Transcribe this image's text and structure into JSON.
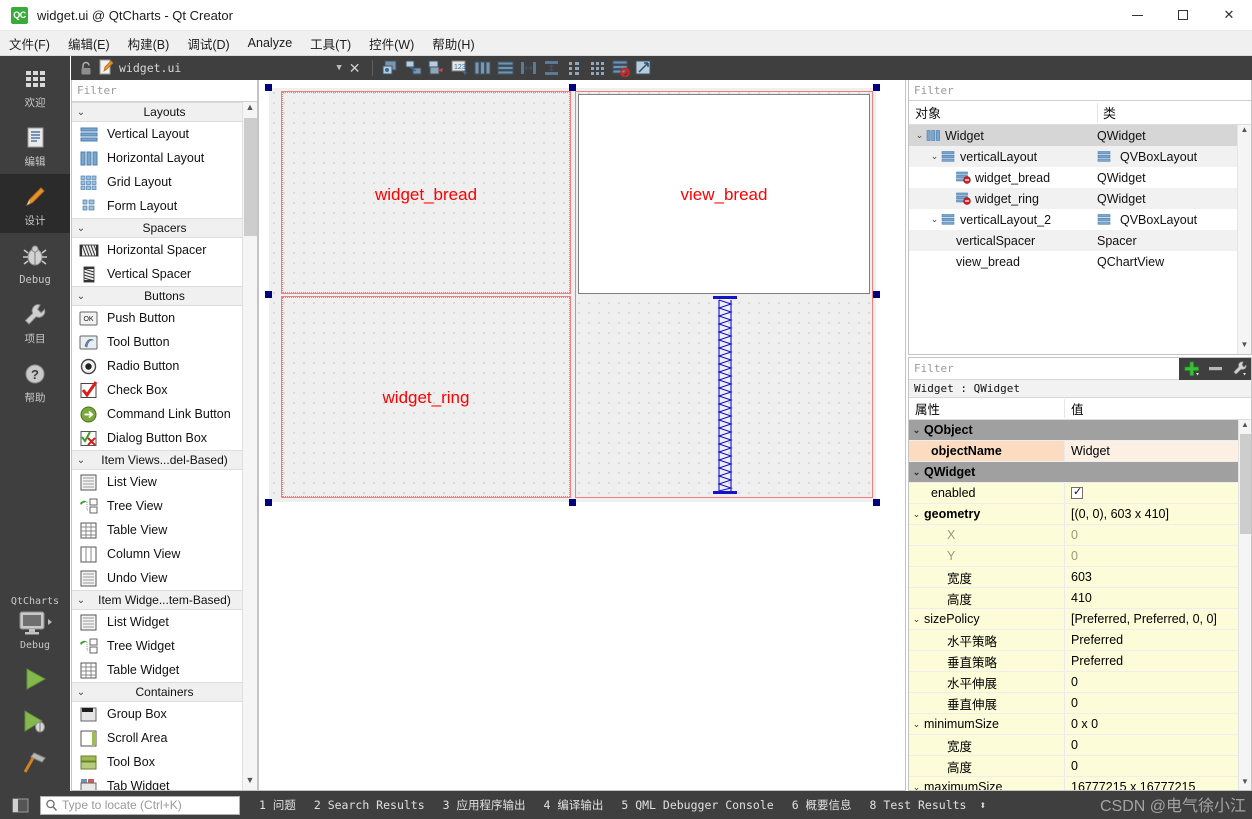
{
  "window": {
    "title": "widget.ui @ QtCharts - Qt Creator",
    "logo_text": "QC",
    "minimize": "minimize-button",
    "maximize": "maximize-button",
    "close": "close-button"
  },
  "menubar": {
    "items": [
      {
        "label": "文件(F)"
      },
      {
        "label": "编辑(E)"
      },
      {
        "label": "构建(B)"
      },
      {
        "label": "调试(D)"
      },
      {
        "label": "Analyze"
      },
      {
        "label": "工具(T)"
      },
      {
        "label": "控件(W)"
      },
      {
        "label": "帮助(H)"
      }
    ]
  },
  "modebar": {
    "items": [
      {
        "label": "欢迎",
        "icon": "grid-icon",
        "active": false
      },
      {
        "label": "编辑",
        "icon": "document-icon",
        "active": false
      },
      {
        "label": "设计",
        "icon": "pencil-icon",
        "active": true
      },
      {
        "label": "Debug",
        "icon": "bug-icon",
        "active": false
      },
      {
        "label": "项目",
        "icon": "wrench-icon",
        "active": false
      },
      {
        "label": "帮助",
        "icon": "question-icon",
        "active": false
      }
    ],
    "kit": {
      "name": "QtCharts",
      "build_config": "Debug",
      "icon": "monitor-icon"
    },
    "run_button": "run-icon",
    "debug_button": "debug-run-icon",
    "build_button": "hammer-icon"
  },
  "form_toolbar": {
    "lock": "lock-icon",
    "file_icon": "ui-file-icon",
    "file_name": "widget.ui",
    "dropdown": "chevron-down-icon",
    "close": "close-document-icon",
    "tools": [
      {
        "name": "edit-widgets-icon"
      },
      {
        "name": "edit-signals-slots-icon"
      },
      {
        "name": "edit-buddies-icon"
      },
      {
        "name": "edit-tab-order-icon"
      },
      {
        "name": "layout-horizontally-icon"
      },
      {
        "name": "layout-vertically-icon"
      },
      {
        "name": "layout-horizontal-splitter-icon"
      },
      {
        "name": "layout-vertical-splitter-icon"
      },
      {
        "name": "layout-form-icon"
      },
      {
        "name": "layout-grid-icon"
      },
      {
        "name": "break-layout-icon"
      },
      {
        "name": "adjust-size-icon"
      }
    ]
  },
  "widgetbox": {
    "filter_placeholder": "Filter",
    "groups": [
      {
        "label": "Layouts",
        "items": [
          {
            "label": "Vertical Layout",
            "icon": "vertical-layout-icon"
          },
          {
            "label": "Horizontal Layout",
            "icon": "horizontal-layout-icon"
          },
          {
            "label": "Grid Layout",
            "icon": "grid-layout-icon"
          },
          {
            "label": "Form Layout",
            "icon": "form-layout-icon"
          }
        ]
      },
      {
        "label": "Spacers",
        "items": [
          {
            "label": "Horizontal Spacer",
            "icon": "horizontal-spacer-icon"
          },
          {
            "label": "Vertical Spacer",
            "icon": "vertical-spacer-icon"
          }
        ]
      },
      {
        "label": "Buttons",
        "items": [
          {
            "label": "Push Button",
            "icon": "push-button-icon"
          },
          {
            "label": "Tool Button",
            "icon": "tool-button-icon"
          },
          {
            "label": "Radio Button",
            "icon": "radio-button-icon"
          },
          {
            "label": "Check Box",
            "icon": "check-box-icon"
          },
          {
            "label": "Command Link Button",
            "icon": "command-link-button-icon"
          },
          {
            "label": "Dialog Button Box",
            "icon": "dialog-button-box-icon"
          }
        ]
      },
      {
        "label": "Item Views...del-Based)",
        "items": [
          {
            "label": "List View",
            "icon": "list-view-icon"
          },
          {
            "label": "Tree View",
            "icon": "tree-view-icon"
          },
          {
            "label": "Table View",
            "icon": "table-view-icon"
          },
          {
            "label": "Column View",
            "icon": "column-view-icon"
          },
          {
            "label": "Undo View",
            "icon": "undo-view-icon"
          }
        ]
      },
      {
        "label": "Item Widge...tem-Based)",
        "items": [
          {
            "label": "List Widget",
            "icon": "list-widget-icon"
          },
          {
            "label": "Tree Widget",
            "icon": "tree-widget-icon"
          },
          {
            "label": "Table Widget",
            "icon": "table-widget-icon"
          }
        ]
      },
      {
        "label": "Containers",
        "items": [
          {
            "label": "Group Box",
            "icon": "group-box-icon"
          },
          {
            "label": "Scroll Area",
            "icon": "scroll-area-icon"
          },
          {
            "label": "Tool Box",
            "icon": "tool-box-icon"
          },
          {
            "label": "Tab Widget",
            "icon": "tab-widget-icon"
          }
        ]
      }
    ]
  },
  "canvas": {
    "widgets": [
      {
        "label": "widget_bread",
        "type": "QWidget"
      },
      {
        "label": "view_bread",
        "type": "QChartView"
      },
      {
        "label": "widget_ring",
        "type": "QWidget"
      },
      {
        "label": "",
        "type": "Spacer"
      }
    ]
  },
  "objecttree": {
    "filter_placeholder": "Filter",
    "columns": [
      "对象",
      "类"
    ],
    "rows": [
      {
        "name": "Widget",
        "class": "QWidget",
        "indent": 0,
        "chevron": true,
        "icon": "horizontal-layout-icon",
        "class_icon": "",
        "selected": true
      },
      {
        "name": "verticalLayout",
        "class": "QVBoxLayout",
        "indent": 1,
        "chevron": true,
        "icon": "vertical-layout-icon",
        "class_icon": "vertical-layout-icon",
        "selected": false
      },
      {
        "name": "widget_bread",
        "class": "QWidget",
        "indent": 2,
        "chevron": false,
        "icon": "widget-nolayout-icon",
        "class_icon": "",
        "selected": false
      },
      {
        "name": "widget_ring",
        "class": "QWidget",
        "indent": 2,
        "chevron": false,
        "icon": "widget-nolayout-icon",
        "class_icon": "",
        "selected": false
      },
      {
        "name": "verticalLayout_2",
        "class": "QVBoxLayout",
        "indent": 1,
        "chevron": true,
        "icon": "vertical-layout-icon",
        "class_icon": "vertical-layout-icon",
        "selected": false
      },
      {
        "name": "verticalSpacer",
        "class": "Spacer",
        "indent": 2,
        "chevron": false,
        "icon": "",
        "class_icon": "",
        "selected": false
      },
      {
        "name": "view_bread",
        "class": "QChartView",
        "indent": 2,
        "chevron": false,
        "icon": "",
        "class_icon": "",
        "selected": false
      }
    ]
  },
  "properties": {
    "filter_placeholder": "Filter",
    "add_button": "add-icon",
    "remove_button": "remove-icon",
    "configure_button": "configure-icon",
    "object_header": "Widget : QWidget",
    "columns": [
      "属性",
      "值"
    ],
    "rows": [
      {
        "name": "QObject",
        "value": "",
        "kind": "group",
        "indent": 0,
        "chevron": true
      },
      {
        "name": "objectName",
        "value": "Widget",
        "kind": "peach",
        "indent": 1,
        "chevron": false,
        "bold": true
      },
      {
        "name": "QWidget",
        "value": "",
        "kind": "group",
        "indent": 0,
        "chevron": true
      },
      {
        "name": "enabled",
        "value": "",
        "kind": "yellow",
        "indent": 1,
        "chevron": false,
        "checkbox": true
      },
      {
        "name": "geometry",
        "value": "[(0, 0), 603 x 410]",
        "kind": "yellow",
        "indent": 0,
        "chevron": true,
        "bold": true
      },
      {
        "name": "X",
        "value": "0",
        "kind": "yellow",
        "indent": 2,
        "chevron": false,
        "dim": true
      },
      {
        "name": "Y",
        "value": "0",
        "kind": "yellow",
        "indent": 2,
        "chevron": false,
        "dim": true
      },
      {
        "name": "宽度",
        "value": "603",
        "kind": "yellow",
        "indent": 2,
        "chevron": false
      },
      {
        "name": "高度",
        "value": "410",
        "kind": "yellow",
        "indent": 2,
        "chevron": false
      },
      {
        "name": "sizePolicy",
        "value": "[Preferred, Preferred, 0, 0]",
        "kind": "yellow",
        "indent": 0,
        "chevron": true
      },
      {
        "name": "水平策略",
        "value": "Preferred",
        "kind": "yellow",
        "indent": 2,
        "chevron": false
      },
      {
        "name": "垂直策略",
        "value": "Preferred",
        "kind": "yellow",
        "indent": 2,
        "chevron": false
      },
      {
        "name": "水平伸展",
        "value": "0",
        "kind": "yellow",
        "indent": 2,
        "chevron": false
      },
      {
        "name": "垂直伸展",
        "value": "0",
        "kind": "yellow",
        "indent": 2,
        "chevron": false
      },
      {
        "name": "minimumSize",
        "value": "0 x 0",
        "kind": "yellow",
        "indent": 0,
        "chevron": true
      },
      {
        "name": "宽度",
        "value": "0",
        "kind": "yellow",
        "indent": 2,
        "chevron": false
      },
      {
        "name": "高度",
        "value": "0",
        "kind": "yellow",
        "indent": 2,
        "chevron": false
      },
      {
        "name": "maximumSize",
        "value": "16777215 x 16777215",
        "kind": "yellow",
        "indent": 0,
        "chevron": true
      }
    ]
  },
  "statusbar": {
    "sidebar_toggle": "toggle-sidebar-icon",
    "locate_placeholder": "Type to locate (Ctrl+K)",
    "search_icon": "search-icon",
    "items": [
      "1 问题",
      "2 Search Results",
      "3 应用程序输出",
      "4 编译输出",
      "5 QML Debugger Console",
      "6 概要信息",
      "8 Test Results"
    ],
    "resize_handle": "updown-arrows-icon",
    "watermark": "CSDN @电气徐小江"
  }
}
